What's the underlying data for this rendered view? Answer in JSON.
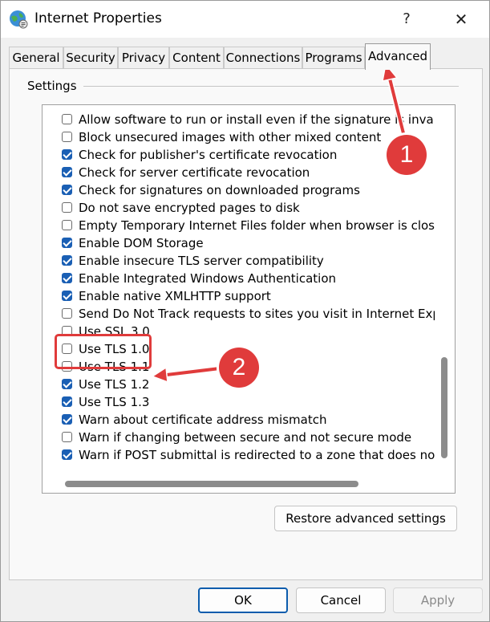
{
  "window": {
    "title": "Internet Properties",
    "help_glyph": "?",
    "close_glyph": "✕",
    "icon": "globe-settings-icon"
  },
  "tabs": [
    {
      "label": "General",
      "active": false
    },
    {
      "label": "Security",
      "active": false
    },
    {
      "label": "Privacy",
      "active": false
    },
    {
      "label": "Content",
      "active": false
    },
    {
      "label": "Connections",
      "active": false
    },
    {
      "label": "Programs",
      "active": false
    },
    {
      "label": "Advanced",
      "active": true
    }
  ],
  "settings": {
    "group_label": "Settings",
    "items": [
      {
        "label": "Allow software to run or install even if the signature is invalid",
        "checked": false
      },
      {
        "label": "Block unsecured images with other mixed content",
        "checked": false
      },
      {
        "label": "Check for publisher's certificate revocation",
        "checked": true
      },
      {
        "label": "Check for server certificate revocation",
        "checked": true
      },
      {
        "label": "Check for signatures on downloaded programs",
        "checked": true
      },
      {
        "label": "Do not save encrypted pages to disk",
        "checked": false
      },
      {
        "label": "Empty Temporary Internet Files folder when browser is closed",
        "checked": false
      },
      {
        "label": "Enable DOM Storage",
        "checked": true
      },
      {
        "label": "Enable insecure TLS server compatibility",
        "checked": true
      },
      {
        "label": "Enable Integrated Windows Authentication",
        "checked": true
      },
      {
        "label": "Enable native XMLHTTP support",
        "checked": true
      },
      {
        "label": "Send Do Not Track requests to sites you visit in Internet Explorer",
        "checked": false
      },
      {
        "label": "Use SSL 3.0",
        "checked": false
      },
      {
        "label": "Use TLS 1.0",
        "checked": false
      },
      {
        "label": "Use TLS 1.1",
        "checked": false
      },
      {
        "label": "Use TLS 1.2",
        "checked": true
      },
      {
        "label": "Use TLS 1.3",
        "checked": true
      },
      {
        "label": "Warn about certificate address mismatch",
        "checked": true
      },
      {
        "label": "Warn if changing between secure and not secure mode",
        "checked": false
      },
      {
        "label": "Warn if POST submittal is redirected to a zone that does not permit posts",
        "checked": true
      }
    ],
    "restore_button": "Restore advanced settings"
  },
  "buttons": {
    "ok": "OK",
    "cancel": "Cancel",
    "apply": "Apply",
    "apply_enabled": false
  },
  "annotations": {
    "badge_1": "1",
    "badge_2": "2",
    "color": "#e03b3b"
  }
}
